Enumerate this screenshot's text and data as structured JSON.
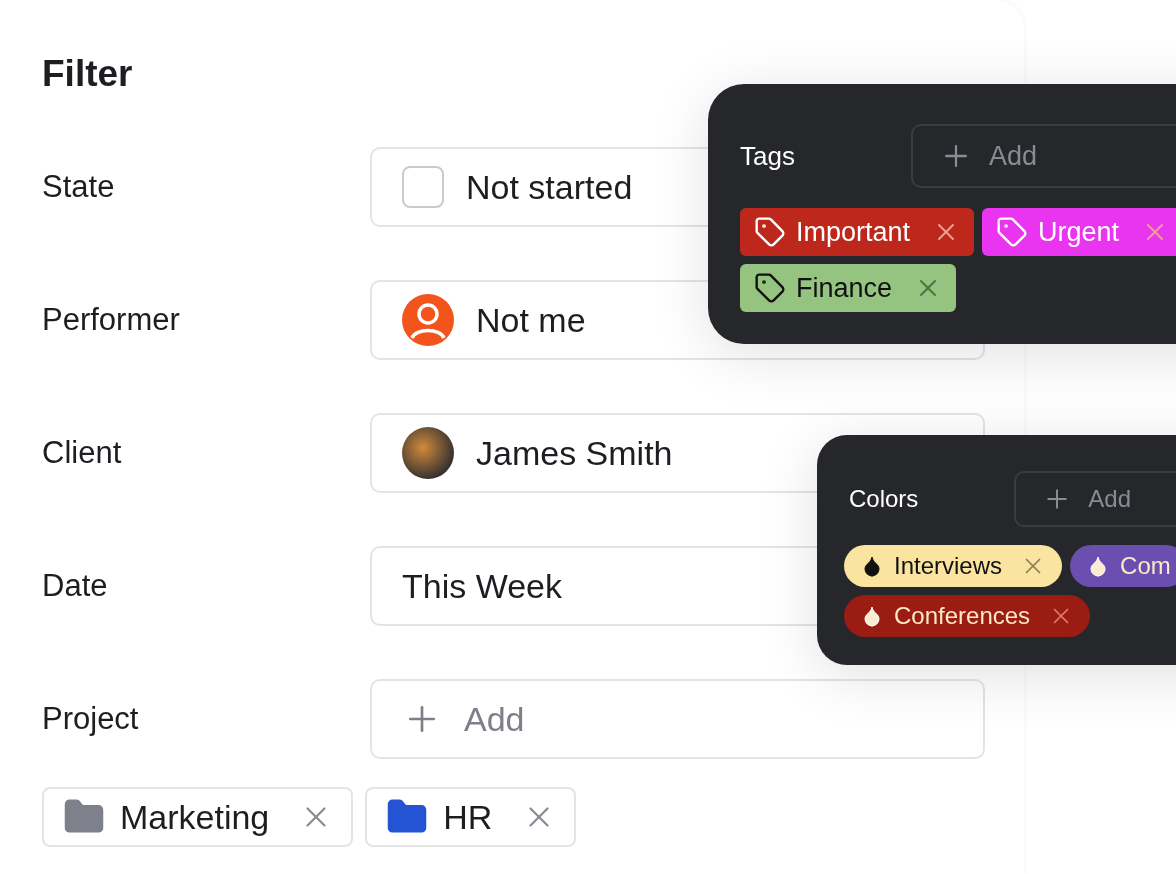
{
  "title": "Filter",
  "fields": [
    {
      "label": "State",
      "kind": "checkbox",
      "value": "Not started",
      "checked": false
    },
    {
      "label": "Performer",
      "kind": "user",
      "value": "Not me"
    },
    {
      "label": "Client",
      "kind": "photo",
      "value": "James Smith"
    },
    {
      "label": "Date",
      "kind": "text",
      "value": "This Week"
    },
    {
      "label": "Project",
      "kind": "add",
      "placeholder": "Add"
    }
  ],
  "projects": [
    {
      "label": "Marketing",
      "color": "#7e808c"
    },
    {
      "label": "HR",
      "color": "#2453d4"
    }
  ],
  "tags_panel": {
    "label": "Tags",
    "placeholder": "Add",
    "chips": [
      {
        "label": "Important",
        "color": "#bd271c"
      },
      {
        "label": "Urgent",
        "color": "#e935f0"
      },
      {
        "label": "Finance",
        "color": "#94c47f"
      }
    ]
  },
  "colors_panel": {
    "label": "Colors",
    "placeholder": "Add",
    "chips": [
      {
        "label": "Interviews",
        "color": "#fbe3a0"
      },
      {
        "label": "Com",
        "color": "#6a4fb0"
      },
      {
        "label": "Conferences",
        "color": "#9a1c12"
      }
    ]
  }
}
